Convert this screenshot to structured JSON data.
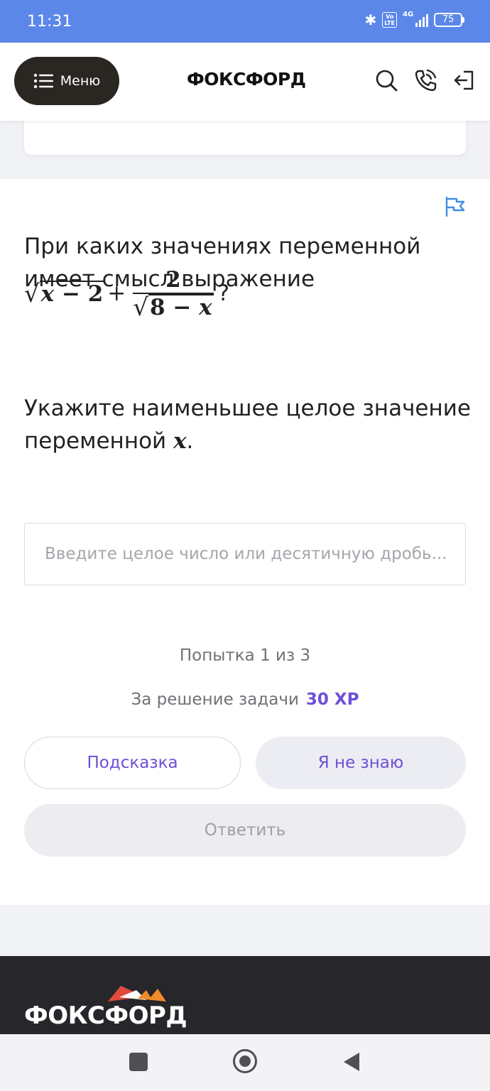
{
  "status_bar": {
    "time": "11:31",
    "volte_label": "Vo\nLTE",
    "network_label": "4G",
    "battery_level": "75"
  },
  "header": {
    "menu_label": "Меню",
    "logo": "ФОКСФОРД",
    "icons": [
      "search-icon",
      "phone-icon",
      "logout-icon"
    ]
  },
  "task": {
    "question_text": "При каких значениях переменной имеет смысл выражение",
    "expr": {
      "sqrt_arg_var": "x",
      "sqrt_arg_rest": " − 2",
      "plus": "+",
      "frac_num": "2",
      "frac_den_num": "8 − ",
      "frac_den_var": "x",
      "qmark": "?"
    },
    "prompt_text": "Укажите наименьшее целое значение переменной",
    "prompt_var": "x",
    "prompt_end": ".",
    "answer_placeholder": "Введите целое число или десятичную дробь...",
    "answer_value": "",
    "attempt_text": "Попытка 1 из 3",
    "reward_text": "За решение задачи",
    "reward_xp": "30 XP",
    "hint_label": "Подсказка",
    "dont_know_label": "Я не знаю",
    "submit_label": "Ответить"
  },
  "footer": {
    "logo": "ФОКСФОРД"
  },
  "colors": {
    "status_bar": "#5b87e9",
    "accent_purple": "#6e4fd8",
    "menu_dark": "#2a2622",
    "footer_dark": "#26262b",
    "flag_blue": "#3f8ee6"
  }
}
